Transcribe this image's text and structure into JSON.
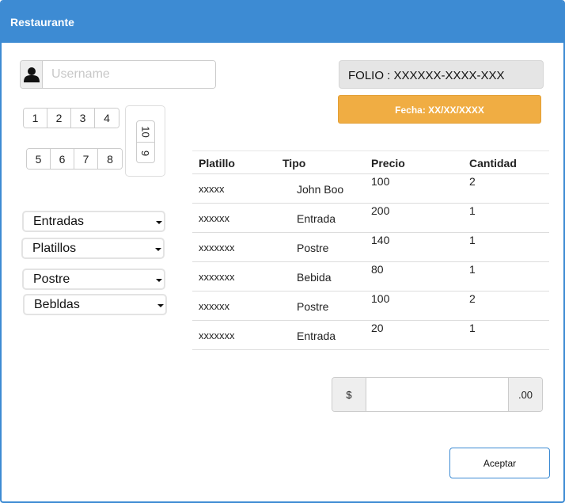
{
  "window": {
    "title": "Restaurante"
  },
  "login": {
    "placeholder": "Username"
  },
  "pager": {
    "group1": [
      "1",
      "2",
      "3",
      "4"
    ],
    "group2": [
      "5",
      "6",
      "7",
      "8"
    ],
    "vertical": [
      "10",
      "9"
    ]
  },
  "menus": [
    {
      "label": "Entradas"
    },
    {
      "label": "Platillos"
    },
    {
      "label": "Postre"
    },
    {
      "label": "Bebldas"
    }
  ],
  "folio": "FOLIO : XXXXXX-XXXX-XXX",
  "fecha": "Fecha: XX/XX/XXXX",
  "table": {
    "headers": {
      "platillo": "Platillo",
      "tipo": "Tipo",
      "precio": "Precio",
      "cantidad": "Cantidad"
    },
    "rows": [
      {
        "platillo": "xxxxx",
        "tipo": "John Boo",
        "precio": "100",
        "cantidad": "2"
      },
      {
        "platillo": "xxxxxx",
        "tipo": "Entrada",
        "precio": "200",
        "cantidad": "1"
      },
      {
        "platillo": "xxxxxxx",
        "tipo": "Postre",
        "precio": "140",
        "cantidad": "1"
      },
      {
        "platillo": "xxxxxxx",
        "tipo": "Bebida",
        "precio": "80",
        "cantidad": "1"
      },
      {
        "platillo": "xxxxxx",
        "tipo": "Postre",
        "precio": "100",
        "cantidad": "2"
      },
      {
        "platillo": "xxxxxxx",
        "tipo": "Entrada",
        "precio": "20",
        "cantidad": "1"
      }
    ]
  },
  "total": {
    "prefix": "$",
    "suffix": ".00",
    "value": ""
  },
  "accept_label": "Aceptar",
  "colors": {
    "titlebar": "#3d8bd3",
    "fecha": "#f0ad43"
  },
  "icons": {
    "user": "user-icon",
    "caret": "caret-down-icon"
  }
}
